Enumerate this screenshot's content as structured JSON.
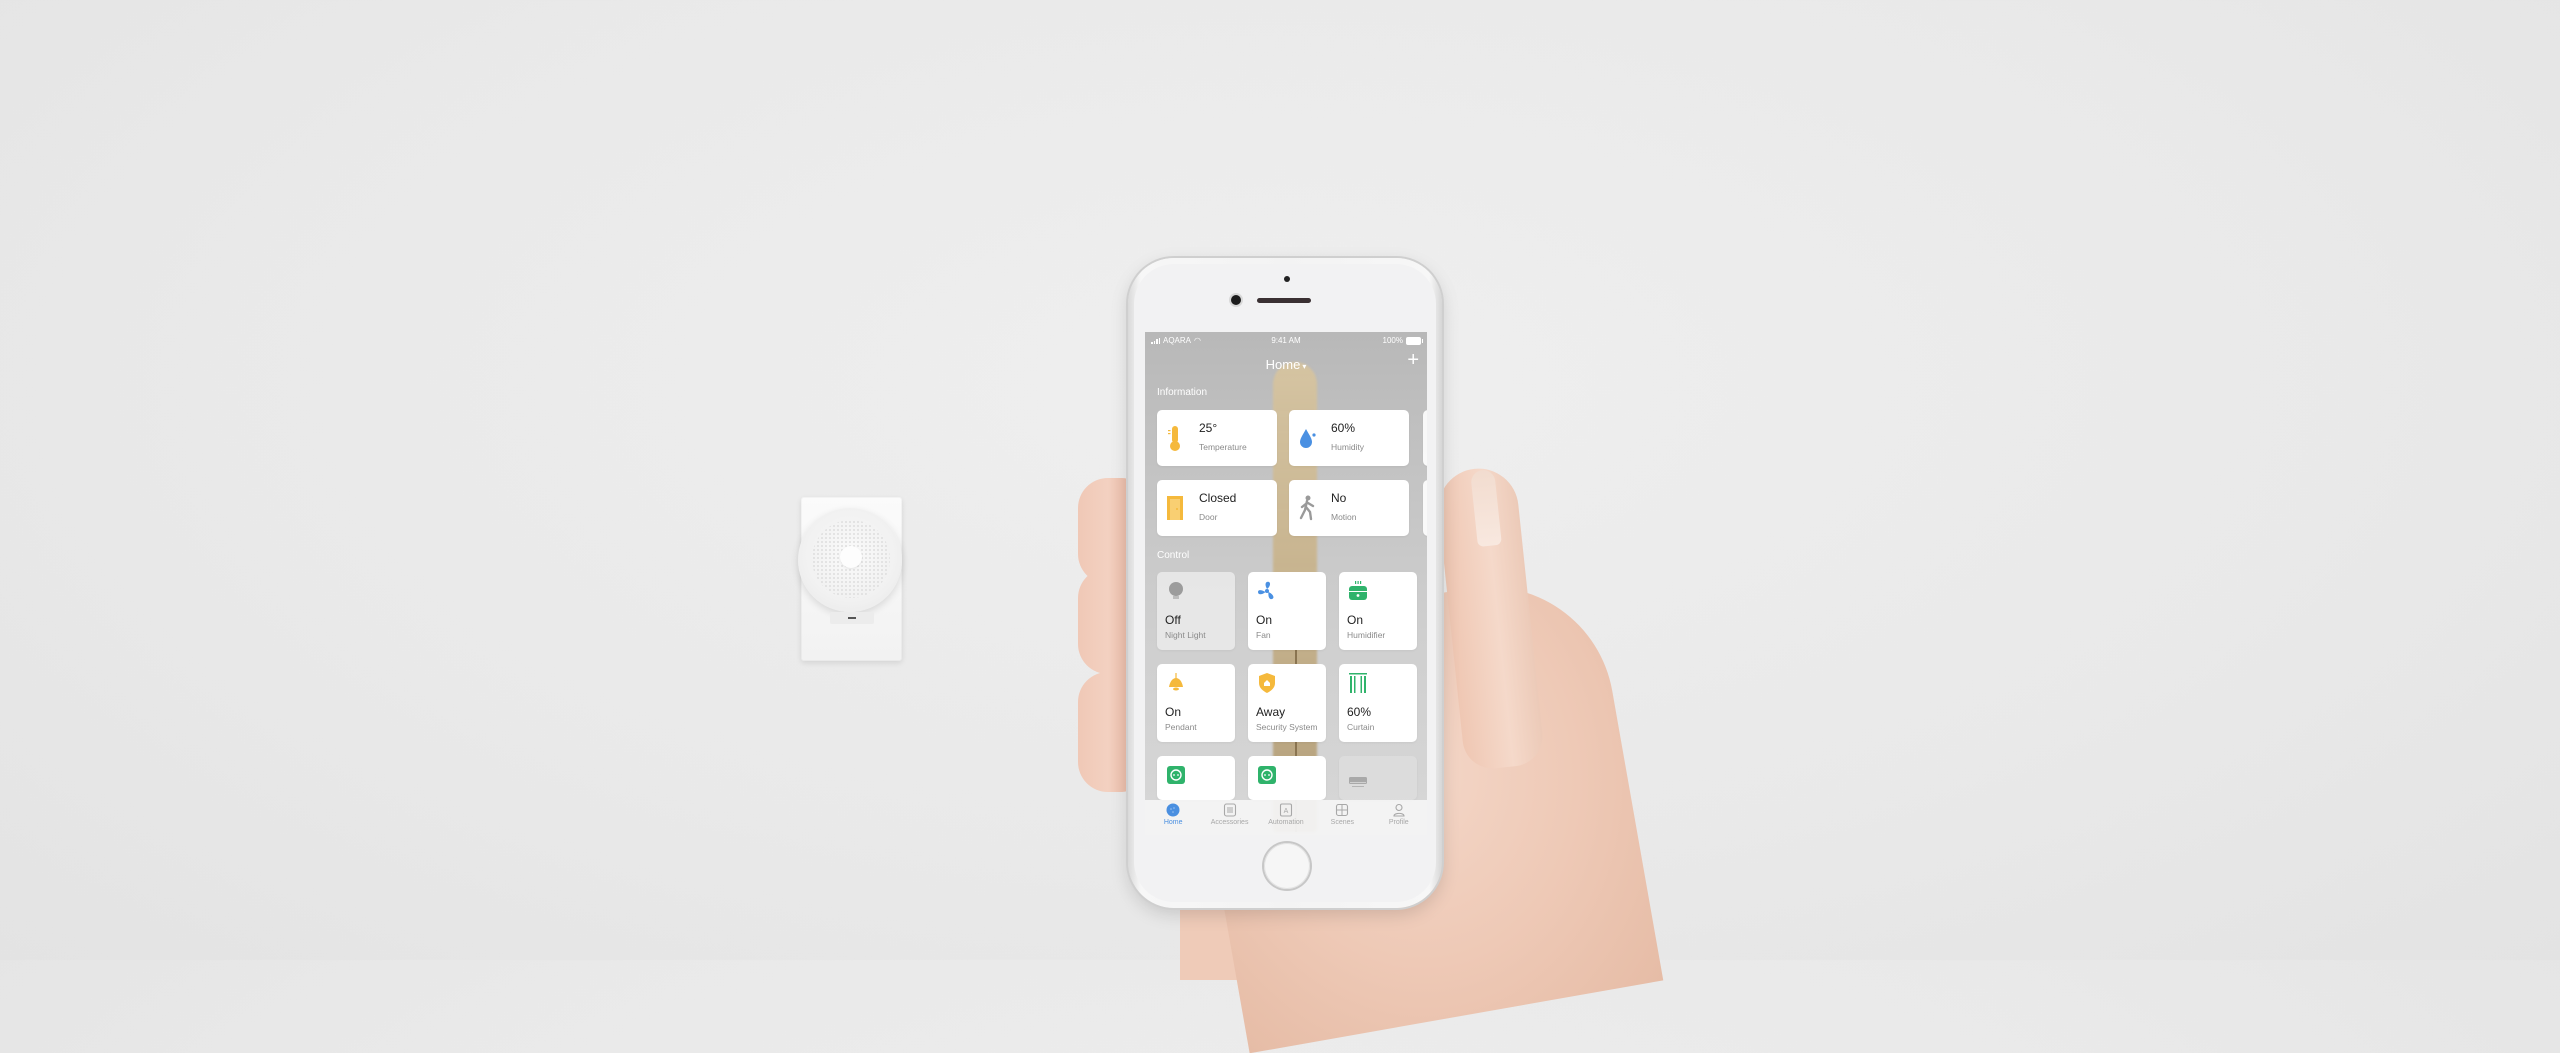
{
  "hub_device": {
    "name": "Smart home hub"
  },
  "phone": {
    "status_bar": {
      "carrier": "AQARA",
      "time": "9:41 AM",
      "battery": "100%"
    },
    "nav": {
      "title": "Home",
      "add_label": "+"
    },
    "sections": {
      "information_label": "Information",
      "control_label": "Control"
    },
    "information_cards": [
      {
        "value": "25°",
        "label": "Temperature",
        "icon": "thermometer-icon",
        "color": "#f5b93c"
      },
      {
        "value": "60%",
        "label": "Humidity",
        "icon": "water-drop-icon",
        "color": "#4a90e2"
      },
      {
        "value": "Closed",
        "label": "Door",
        "icon": "door-icon",
        "color": "#f5b93c"
      },
      {
        "value": "No",
        "label": "Motion",
        "icon": "walking-person-icon",
        "color": "#9a9a9a"
      }
    ],
    "control_cards": [
      {
        "value": "Off",
        "label": "Night Light",
        "icon": "bulb-icon",
        "color": "#9c9c9c",
        "state": "off"
      },
      {
        "value": "On",
        "label": "Fan",
        "icon": "fan-icon",
        "color": "#4a90e2",
        "state": "on"
      },
      {
        "value": "On",
        "label": "Humidifier",
        "icon": "humidifier-icon",
        "color": "#2fb36b",
        "state": "on"
      },
      {
        "value": "On",
        "label": "Pendant",
        "icon": "pendant-lamp-icon",
        "color": "#f5b93c",
        "state": "on"
      },
      {
        "value": "Away",
        "label": "Security System",
        "icon": "shield-icon",
        "color": "#f5b93c",
        "state": "on"
      },
      {
        "value": "60%",
        "label": "Curtain",
        "icon": "curtain-icon",
        "color": "#2fb36b",
        "state": "on"
      },
      {
        "value": "",
        "label": "",
        "icon": "outlet-icon",
        "color": "#2fb36b",
        "state": "on"
      },
      {
        "value": "",
        "label": "",
        "icon": "outlet-icon",
        "color": "#2fb36b",
        "state": "on"
      },
      {
        "value": "",
        "label": "",
        "icon": "air-conditioner-icon",
        "color": "#9c9c9c",
        "state": "off"
      }
    ],
    "tab_bar": [
      {
        "label": "Home",
        "icon": "home-dot-icon",
        "active": true
      },
      {
        "label": "Accessories",
        "icon": "list-icon",
        "active": false
      },
      {
        "label": "Automation",
        "icon": "automation-icon",
        "active": false
      },
      {
        "label": "Scenes",
        "icon": "grid-icon",
        "active": false
      },
      {
        "label": "Profile",
        "icon": "profile-icon",
        "active": false
      }
    ],
    "accent_color": "#4a8fe0"
  }
}
